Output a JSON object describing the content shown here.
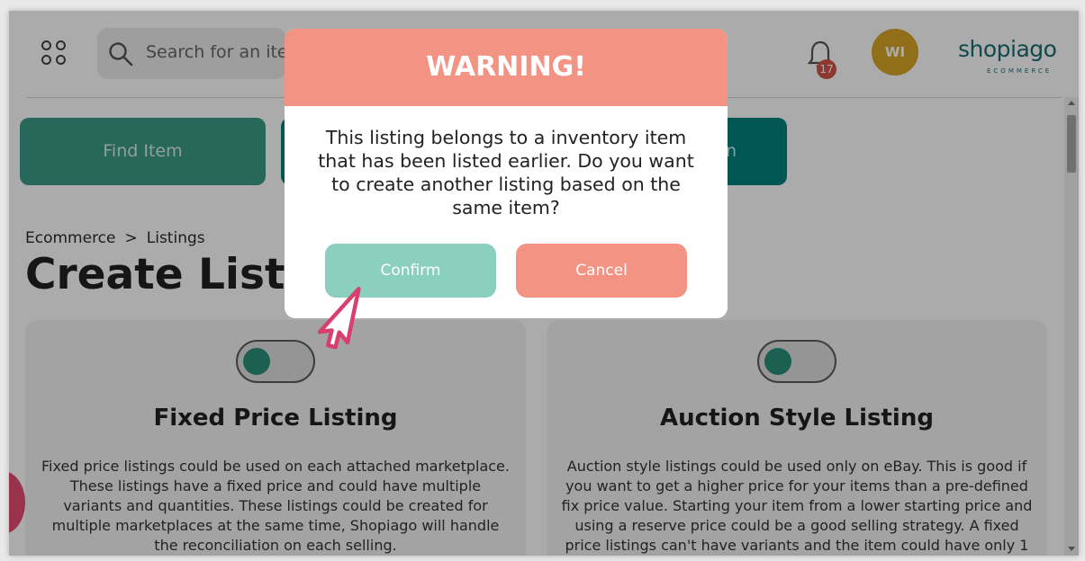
{
  "header": {
    "apps_icon": "apps-grid-icon",
    "search": {
      "placeholder": "Search for an iter",
      "icon": "search-icon"
    },
    "notifications": {
      "icon": "bell-icon",
      "count": "17"
    },
    "avatar": {
      "initials": "WI",
      "color": "#d8a426"
    },
    "logo": {
      "name": "shopiago",
      "tagline": "ECOMMERCE"
    }
  },
  "actions": {
    "find_item": "Find Item",
    "second_button_fragment": "n"
  },
  "breadcrumb": {
    "items": [
      "Ecommerce",
      "Listings"
    ],
    "separator": ">"
  },
  "page": {
    "title": "Create Listir"
  },
  "cards": [
    {
      "title": "Fixed Price Listing",
      "description": "Fixed price listings could be used on each attached marketplace. These listings have a fixed price and could have multiple variants and quantities. These listings could be created for multiple marketplaces at the same time, Shopiago will handle the reconciliation on each selling."
    },
    {
      "title": "Auction Style Listing",
      "description": "Auction style listings could be used only on eBay. This is good if you want to get a higher price for your items than a pre-defined fix price value. Starting your item from a lower starting price and using a reserve price could be a good selling strategy. A fixed price listings can't have variants and the item could have only 1"
    }
  ],
  "modal": {
    "title": "WARNING!",
    "message": "This listing belongs to a inventory item that has been listed earlier. Do you want to create another listing based on the same item?",
    "confirm_label": "Confirm",
    "cancel_label": "Cancel"
  },
  "colors": {
    "warning": "#f39383",
    "confirm": "#8acfbf",
    "teal": "#00817b",
    "find": "#3c9b88",
    "cursor": "#d63f6e"
  }
}
